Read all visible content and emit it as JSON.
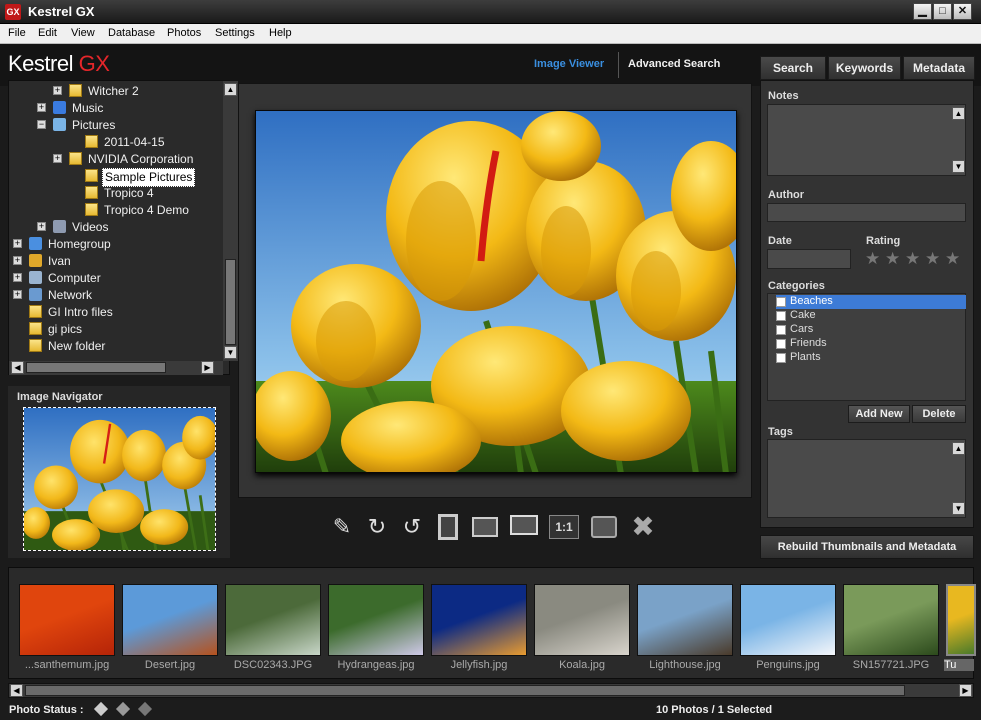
{
  "window": {
    "title": "Kestrel GX",
    "icon_text": "GX"
  },
  "menu": [
    "File",
    "Edit",
    "View",
    "Database",
    "Photos",
    "Settings",
    "Help"
  ],
  "header": {
    "logo_main": "Kestrel",
    "logo_accent": "GX",
    "tab_viewer": "Image Viewer",
    "tab_search": "Advanced Search",
    "accent": "#3a8fe0"
  },
  "right_tabs": [
    "Search",
    "Keywords",
    "Metadata"
  ],
  "tree": [
    {
      "label": "Witcher 2",
      "type": "folder",
      "expander": "+"
    },
    {
      "label": "Music",
      "type": "music",
      "expander": "+"
    },
    {
      "label": "Pictures",
      "type": "pictures",
      "expander": "−"
    },
    {
      "label": "2011-04-15",
      "type": "folder",
      "expander": ""
    },
    {
      "label": "NVIDIA Corporation",
      "type": "folder",
      "expander": "+"
    },
    {
      "label": "Sample Pictures",
      "type": "folder",
      "expander": "",
      "selected": true
    },
    {
      "label": "Tropico 4",
      "type": "folder",
      "expander": ""
    },
    {
      "label": "Tropico 4 Demo",
      "type": "folder",
      "expander": ""
    },
    {
      "label": "Videos",
      "type": "videos",
      "expander": "+"
    },
    {
      "label": "Homegroup",
      "type": "homegroup",
      "expander": "+"
    },
    {
      "label": "Ivan",
      "type": "user",
      "expander": "+"
    },
    {
      "label": "Computer",
      "type": "computer",
      "expander": "+"
    },
    {
      "label": "Network",
      "type": "network",
      "expander": "+"
    },
    {
      "label": "GI Intro files",
      "type": "folder",
      "expander": ""
    },
    {
      "label": "gi pics",
      "type": "folder",
      "expander": ""
    },
    {
      "label": "New folder",
      "type": "folder",
      "expander": ""
    }
  ],
  "navigator": {
    "title": "Image Navigator"
  },
  "toolbar_icons": [
    "pencil-icon",
    "rotate-right-icon",
    "rotate-left-icon",
    "filmstrip-icon",
    "resize-icon",
    "monitor-icon",
    "actual-size-icon",
    "fullscreen-icon",
    "delete-icon"
  ],
  "toolbar_one_to_one": "1:1",
  "panel": {
    "notes_label": "Notes",
    "author_label": "Author",
    "date_label": "Date",
    "rating_label": "Rating",
    "rating": 0,
    "categories_label": "Categories",
    "categories": [
      "Beaches",
      "Cake",
      "Cars",
      "Friends",
      "Plants"
    ],
    "add_new": "Add New",
    "delete": "Delete",
    "tags_label": "Tags",
    "rebuild": "Rebuild Thumbnails and Metadata"
  },
  "thumbnails": [
    {
      "caption": "...santhemum.jpg",
      "colors": [
        "#e0450d",
        "#b52408"
      ]
    },
    {
      "caption": "Desert.jpg",
      "colors": [
        "#5c9ad9",
        "#b5521e"
      ]
    },
    {
      "caption": "DSC02343.JPG",
      "colors": [
        "#4c6a3a",
        "#c8d6c8"
      ]
    },
    {
      "caption": "Hydrangeas.jpg",
      "colors": [
        "#3c6b2c",
        "#cfc9e8"
      ]
    },
    {
      "caption": "Jellyfish.jpg",
      "colors": [
        "#0c2a84",
        "#e89b30"
      ]
    },
    {
      "caption": "Koala.jpg",
      "colors": [
        "#8a8a80",
        "#d8d4cc"
      ]
    },
    {
      "caption": "Lighthouse.jpg",
      "colors": [
        "#7aa2c8",
        "#4a3a2a"
      ]
    },
    {
      "caption": "Penguins.jpg",
      "colors": [
        "#7ab4e6",
        "#f4f6fa"
      ]
    },
    {
      "caption": "SN157721.JPG",
      "colors": [
        "#7a9a5a",
        "#2c4a1c"
      ]
    },
    {
      "caption": "Tu",
      "colors": [
        "#e8b820",
        "#4a7a2a"
      ]
    }
  ],
  "status": {
    "label": "Photo Status :",
    "count": "10 Photos / 1 Selected"
  }
}
